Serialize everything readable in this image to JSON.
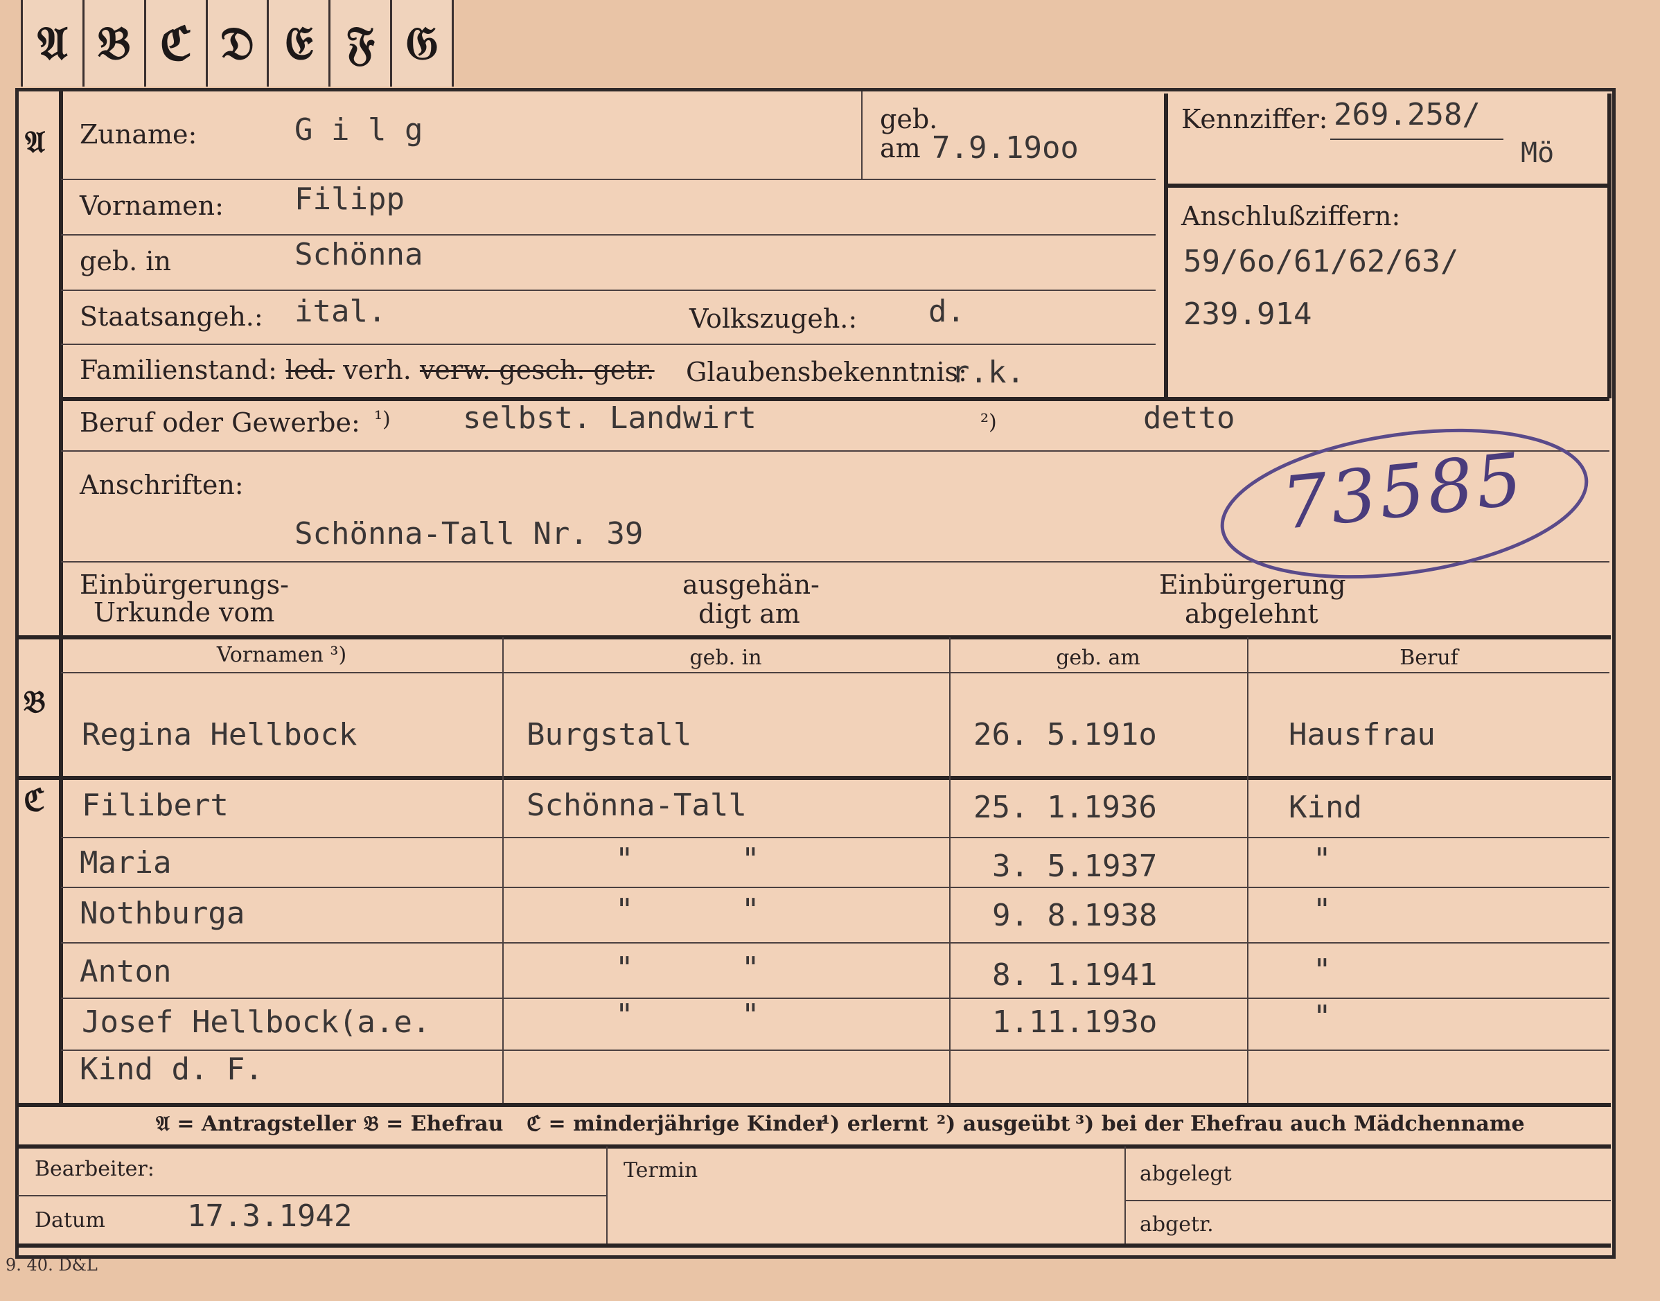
{
  "tabs": [
    "𝔄",
    "𝔅",
    "ℭ",
    "𝔇",
    "𝔈",
    "𝔉",
    "𝔊"
  ],
  "sections": {
    "a": "𝔄",
    "b": "𝔅",
    "c": "ℭ"
  },
  "labels": {
    "zuname": "Zuname:",
    "geb": "geb.",
    "am": "am",
    "kennziffer": "Kennziffer:",
    "vornamen": "Vornamen:",
    "geb_in": "geb. in",
    "anschlussziffern": "Anschlußziffern:",
    "staatsangeh": "Staatsangeh.:",
    "volkszugeh": "Volkszugeh.:",
    "familienstand": "Familienstand:",
    "fam_led": "led.",
    "fam_verh": "verh.",
    "fam_rest": "verw. gesch. getr.",
    "glaubensbekenntnis": "Glaubensbekenntnis:",
    "beruf": "Beruf oder Gewerbe:",
    "beruf_note1": "¹)",
    "beruf_note2": "²)",
    "anschriften": "Anschriften:",
    "einb_urkunde_1": "Einbürgerungs-",
    "einb_urkunde_2": "Urkunde vom",
    "ausgehaendigt_1": "ausgehän-",
    "ausgehaendigt_2": "digt am",
    "einb_abgelehnt_1": "Einbürgerung",
    "einb_abgelehnt_2": "abgelehnt"
  },
  "person": {
    "zuname": "G i l g",
    "geb_am": "7.9.19oo",
    "kennziffer": "269.258/",
    "kennziffer_suffix": "Mö",
    "vornamen": "Filipp",
    "geb_in": "Schönna",
    "anschlussziffern_1": "59/6o/61/62/63/",
    "anschlussziffern_2": "239.914",
    "staatsangeh": "ital.",
    "volkszugeh": "d.",
    "glaubensbekenntnis": "r.k.",
    "beruf_erlernt": "selbst. Landwirt",
    "beruf_ausgeuebt": "detto",
    "anschrift": "Schönna-Tall Nr. 39",
    "stamp_number": "73585"
  },
  "b_headers": {
    "vornamen": "Vornamen ³)",
    "geb_in": "geb. in",
    "geb_am": "geb. am",
    "beruf": "Beruf"
  },
  "spouse": {
    "name": "Regina Hellbock",
    "geb_in": "Burgstall",
    "geb_am": "26. 5.191o",
    "beruf": "Hausfrau"
  },
  "children": [
    {
      "name": "Filibert",
      "geb_in": "Schönna-Tall",
      "geb_am": "25. 1.1936",
      "beruf": "Kind"
    },
    {
      "name": "Maria",
      "geb_in_1": "\"",
      "geb_in_2": "\"",
      "geb_am": "3. 5.1937",
      "beruf": "\""
    },
    {
      "name": "Nothburga",
      "geb_in_1": "\"",
      "geb_in_2": "\"",
      "geb_am": "9. 8.1938",
      "beruf": "\""
    },
    {
      "name": "Anton",
      "geb_in_1": "\"",
      "geb_in_2": "\"",
      "geb_am": "8. 1.1941",
      "beruf": "\""
    },
    {
      "name": "Josef Hellbock(a.e.",
      "geb_in_1": "\"",
      "geb_in_2": "\"",
      "geb_am": "1.11.193o",
      "beruf": "\""
    },
    {
      "name": "Kind d. F."
    }
  ],
  "legend": {
    "a": "𝔄 = Antragsteller",
    "b": "𝔅 = Ehefrau",
    "c": "ℭ = minderjährige Kinder",
    "n1": "¹) erlernt",
    "n2": "²) ausgeübt",
    "n3": "³) bei der Ehefrau auch Mädchenname"
  },
  "footer": {
    "bearbeiter": "Bearbeiter:",
    "datum_label": "Datum",
    "datum": "17.3.1942",
    "termin": "Termin",
    "abgelegt": "abgelegt",
    "abgetr": "abgetr."
  },
  "printer_mark": "9. 40. D&L",
  "colors": {
    "card": "#f2d2b9",
    "ink": "#2a2222",
    "typewriter": "#3a3636",
    "stamp": "#5a4a8a"
  }
}
